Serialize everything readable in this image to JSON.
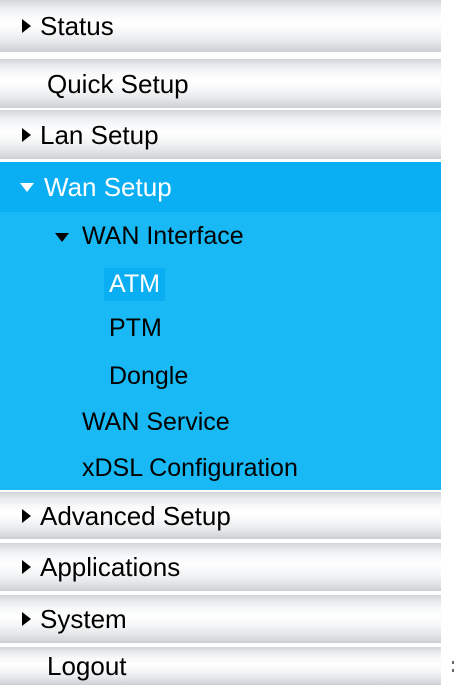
{
  "menu": {
    "items": [
      {
        "label": "Status",
        "icon": "caret-right-icon"
      },
      {
        "label": "Quick Setup"
      },
      {
        "label": "Lan Setup",
        "icon": "caret-right-icon"
      },
      {
        "label": "Wan Setup",
        "icon": "caret-down-icon",
        "expanded": true
      },
      {
        "label": "Advanced Setup",
        "icon": "caret-right-icon"
      },
      {
        "label": "Applications",
        "icon": "caret-right-icon"
      },
      {
        "label": "System",
        "icon": "caret-right-icon"
      },
      {
        "label": "Logout"
      }
    ],
    "wan": {
      "interface_label": "WAN Interface",
      "interface_icon": "caret-down-icon",
      "interface_children": [
        "ATM",
        "PTM",
        "Dongle"
      ],
      "selected": "ATM",
      "service_label": "WAN Service",
      "xdsl_label": "xDSL Configuration"
    }
  },
  "colors": {
    "active_background": "#0aaef2",
    "submenu_background": "#18b9f4",
    "item_background": "#f2f3f4"
  }
}
